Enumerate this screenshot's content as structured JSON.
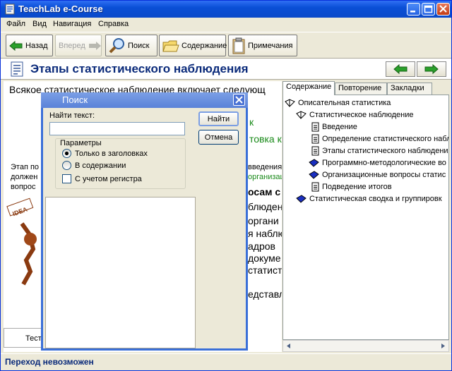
{
  "app": {
    "title": "TeachLab e-Course"
  },
  "menu": [
    "Файл",
    "Вид",
    "Навигация",
    "Справка"
  ],
  "toolbar": {
    "back": "Назад",
    "forward": "Вперед",
    "search": "Поиск",
    "contents": "Содержание",
    "notes": "Примечания"
  },
  "page": {
    "title": "Этапы статистического наблюдения"
  },
  "content": {
    "lead": "Всякое статистическое наблюдение включает следующ",
    "line_right_1": "к",
    "line_right_2": "товка к",
    "left_frag": [
      "Этап по",
      "должен",
      "вопрос"
    ],
    "right_frag": [
      "введения,",
      "организац"
    ],
    "bold_right": "осам с",
    "right_lines": [
      "блюдени",
      "органи",
      "я наблю",
      "адров",
      "докуме",
      "статист",
      "едставл"
    ],
    "idea_label": "IDEA",
    "bottom_tab": "Тест"
  },
  "sidebar": {
    "tabs": [
      "Содержание",
      "Повторение",
      "Закладки"
    ],
    "active_tab": 0,
    "tree": [
      {
        "label": "Описательная статистика",
        "level": 0,
        "icon": "book-open-icon"
      },
      {
        "label": "Статистическое наблюдение",
        "level": 1,
        "icon": "book-open-icon"
      },
      {
        "label": "Введение",
        "level": 2,
        "icon": "page-icon"
      },
      {
        "label": "Определение статистического набл",
        "level": 2,
        "icon": "page-icon"
      },
      {
        "label": "Этапы статистического наблюдения",
        "level": 2,
        "icon": "page-icon"
      },
      {
        "label": "Программно-методологические во",
        "level": 2,
        "icon": "book-closed-icon"
      },
      {
        "label": "Организационные вопросы статис",
        "level": 2,
        "icon": "book-closed-icon"
      },
      {
        "label": "Подведение итогов",
        "level": 2,
        "icon": "page-icon"
      },
      {
        "label": "Статистическая сводка и группировк",
        "level": 1,
        "icon": "book-closed-icon"
      }
    ]
  },
  "dialog": {
    "title": "Поиск",
    "find_label": "Найти текст:",
    "find_value": "",
    "find_button": "Найти",
    "cancel_button": "Отмена",
    "params_label": "Параметры",
    "radio_headings": "Только в заголовках",
    "radio_content": "В содержании",
    "selected_radio": "headings",
    "checkbox_case": "С учетом регистра",
    "checkbox_checked": false
  },
  "status": {
    "text": "Переход невозможен"
  },
  "colors": {
    "title_blue": "#0a4fd6",
    "accent_green": "#1a8a1a",
    "page_title": "#0a2a7a"
  }
}
